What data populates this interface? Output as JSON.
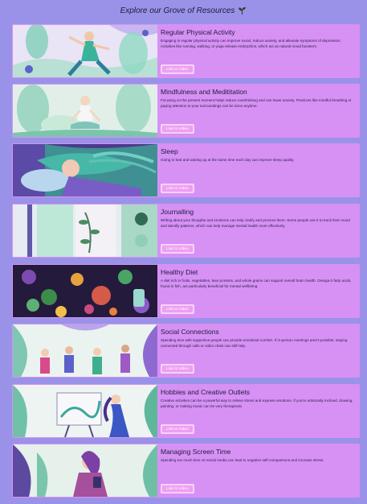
{
  "header": {
    "title": "Explore our Grove of Resources",
    "icon": "sprout-icon"
  },
  "colors": {
    "background": "#9a92e8",
    "card": "#d791f5",
    "button": "#ee9ff2"
  },
  "resources": [
    {
      "title": "Regular Physical Activity",
      "description": "Engaging in regular physical activity can improve mood, reduce anxiety, and alleviate symptoms of depression. Activities like running, walking, or yoga release endorphins, which act as natural mood boosters.",
      "button": "Link to Video"
    },
    {
      "title": "Mindfulness and Medititation",
      "description": "Focusing on the present moment helps reduce overthinking and can lower anxiety. Practices like mindful breathing or paying attention to your surroundings can be done anytime.",
      "button": "Link to Video"
    },
    {
      "title": "Sleep",
      "description": "Going to bed and waking up at the same time each day can improve sleep quality.",
      "button": "Link to Video"
    },
    {
      "title": "Journalling",
      "description": "Writing about your thoughts and emotions can help clarify and process them. Some people use it to track their mood and identify patterns, which can help manage mental health more effectively.",
      "button": "Link to Video"
    },
    {
      "title": "Healthy Diet",
      "description": "A diet rich in fruits, vegetables, lean proteins, and whole grains can support overall brain health. Omega-3 fatty acids, found in fish, are particularly beneficial for mental wellbeing.",
      "button": "Link to Video"
    },
    {
      "title": "Social Connections",
      "description": "Spending time with supportive people can provide emotional comfort. If in-person meetings aren't possible, staying connected through calls or video chats can still help.",
      "button": "Link to Video"
    },
    {
      "title": "Hobbies and Creative Outlets",
      "description": "Creative activities can be a powerful way to relieve stress and express emotions. If you're artistically inclined, drawing, painting, or making music can be very therapeutic.",
      "button": "Link to Video"
    },
    {
      "title": "Managing Screen Time",
      "description": "Spending too much time on social media can lead to negative self-comparisons and increase stress.",
      "button": "Link to Video"
    }
  ]
}
